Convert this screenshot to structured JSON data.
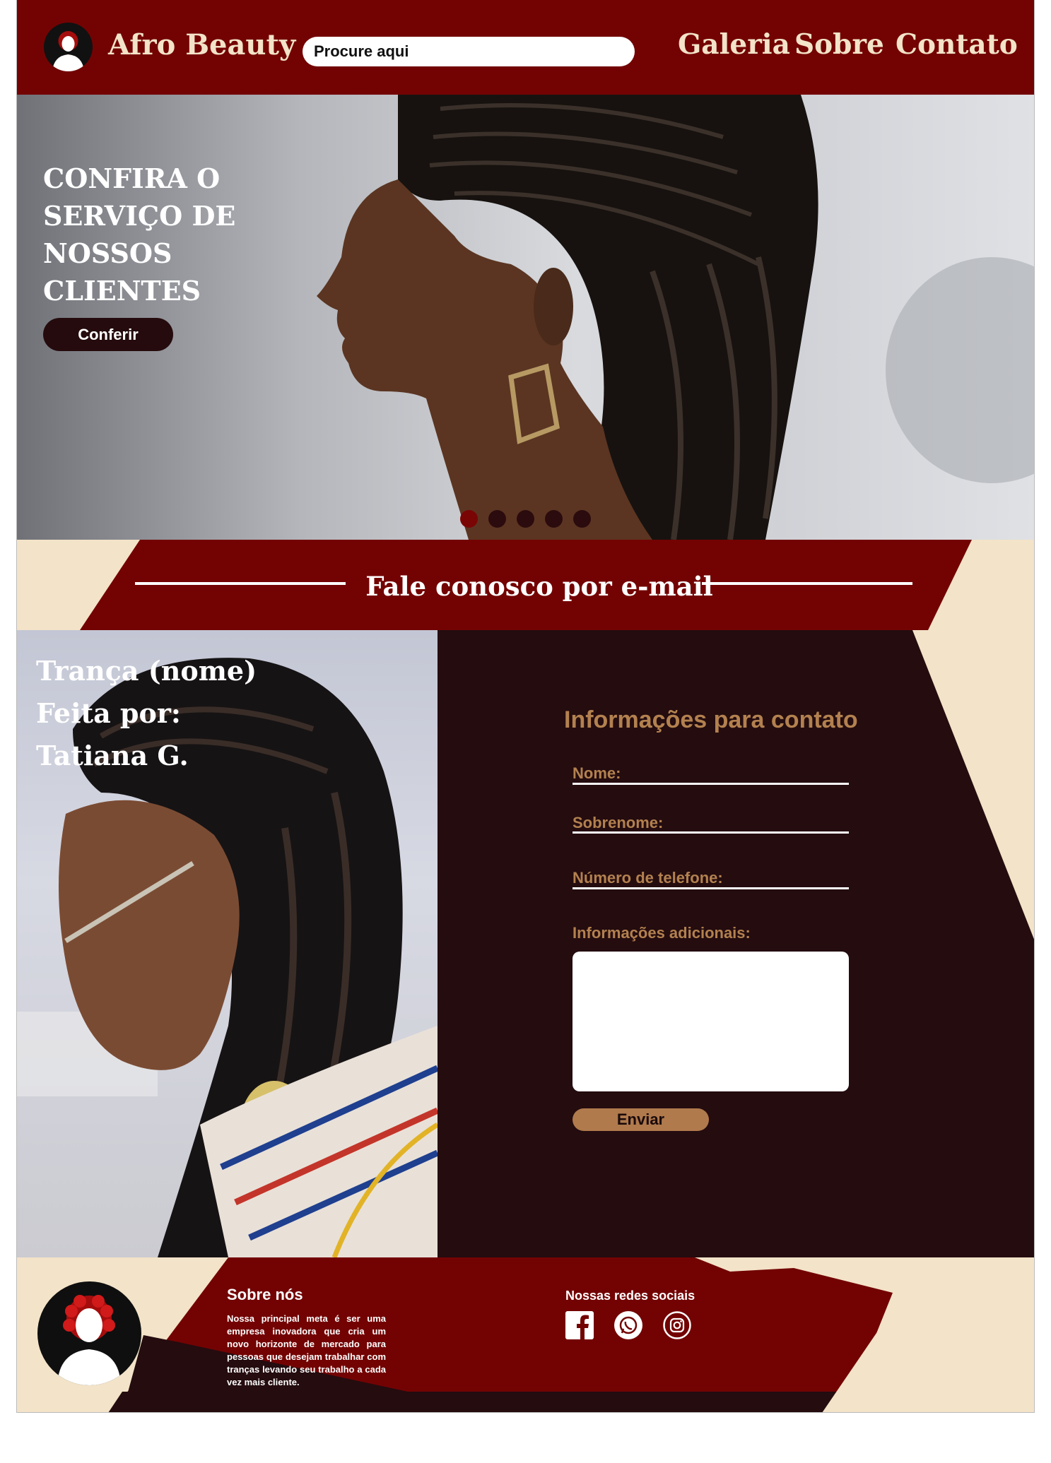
{
  "header": {
    "brand": "Afro Beauty",
    "search_placeholder": "Procure aqui",
    "nav": [
      "Galeria",
      "Sobre",
      "Contato"
    ]
  },
  "hero": {
    "title_lines": [
      "CONFIRA O",
      "SERVIÇO DE",
      "NOSSOS",
      "CLIENTES"
    ],
    "button": "Conferir",
    "slides": 5,
    "active_slide": 1
  },
  "banner": {
    "title": "Fale conosco por e-mail"
  },
  "photo": {
    "caption_lines": [
      "Trança (nome)",
      "Feita por:",
      "Tatiana G."
    ]
  },
  "form": {
    "title": "Informações para contato",
    "fields": [
      "Nome:",
      "Sobrenome:",
      "Número de telefone:"
    ],
    "extra_label": "Informações adicionais:",
    "submit": "Enviar"
  },
  "footer": {
    "about_title": "Sobre nós",
    "about_text": "Nossa principal meta é ser uma empresa inovadora que cria um novo horizonte de mercado para pessoas que desejam trabalhar com tranças levando seu trabalho a cada vez mais cliente.",
    "social_title": "Nossas redes sociais",
    "social_icons": [
      "facebook-icon",
      "whatsapp-icon",
      "instagram-icon"
    ]
  },
  "colors": {
    "maroon": "#730303",
    "dark": "#240c0f",
    "cream": "#f3e3c8",
    "gold": "#b3814f"
  }
}
